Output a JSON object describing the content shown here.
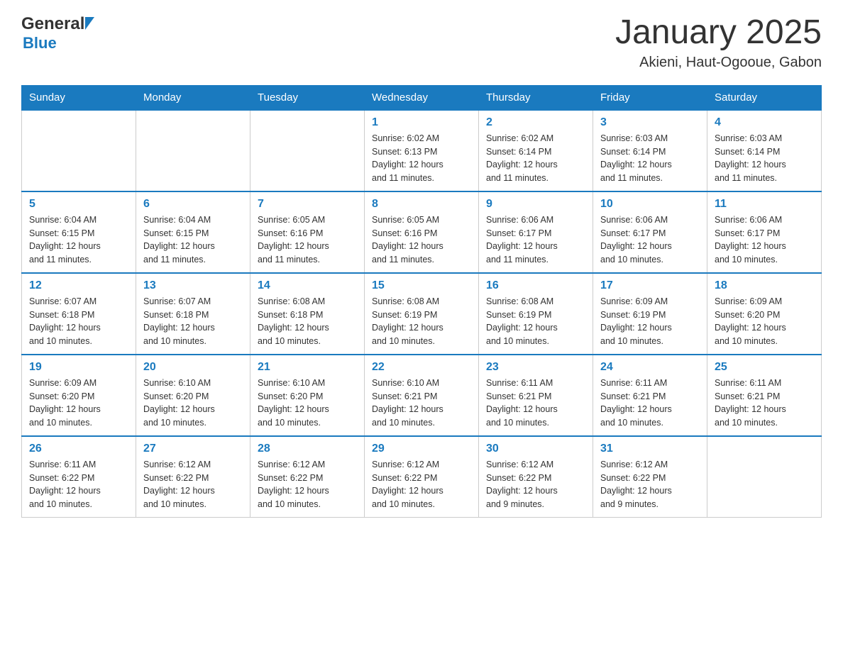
{
  "header": {
    "logo_general": "General",
    "logo_blue": "Blue",
    "title": "January 2025",
    "subtitle": "Akieni, Haut-Ogooue, Gabon"
  },
  "days_of_week": [
    "Sunday",
    "Monday",
    "Tuesday",
    "Wednesday",
    "Thursday",
    "Friday",
    "Saturday"
  ],
  "weeks": [
    [
      {
        "day": "",
        "info": ""
      },
      {
        "day": "",
        "info": ""
      },
      {
        "day": "",
        "info": ""
      },
      {
        "day": "1",
        "info": "Sunrise: 6:02 AM\nSunset: 6:13 PM\nDaylight: 12 hours\nand 11 minutes."
      },
      {
        "day": "2",
        "info": "Sunrise: 6:02 AM\nSunset: 6:14 PM\nDaylight: 12 hours\nand 11 minutes."
      },
      {
        "day": "3",
        "info": "Sunrise: 6:03 AM\nSunset: 6:14 PM\nDaylight: 12 hours\nand 11 minutes."
      },
      {
        "day": "4",
        "info": "Sunrise: 6:03 AM\nSunset: 6:14 PM\nDaylight: 12 hours\nand 11 minutes."
      }
    ],
    [
      {
        "day": "5",
        "info": "Sunrise: 6:04 AM\nSunset: 6:15 PM\nDaylight: 12 hours\nand 11 minutes."
      },
      {
        "day": "6",
        "info": "Sunrise: 6:04 AM\nSunset: 6:15 PM\nDaylight: 12 hours\nand 11 minutes."
      },
      {
        "day": "7",
        "info": "Sunrise: 6:05 AM\nSunset: 6:16 PM\nDaylight: 12 hours\nand 11 minutes."
      },
      {
        "day": "8",
        "info": "Sunrise: 6:05 AM\nSunset: 6:16 PM\nDaylight: 12 hours\nand 11 minutes."
      },
      {
        "day": "9",
        "info": "Sunrise: 6:06 AM\nSunset: 6:17 PM\nDaylight: 12 hours\nand 11 minutes."
      },
      {
        "day": "10",
        "info": "Sunrise: 6:06 AM\nSunset: 6:17 PM\nDaylight: 12 hours\nand 10 minutes."
      },
      {
        "day": "11",
        "info": "Sunrise: 6:06 AM\nSunset: 6:17 PM\nDaylight: 12 hours\nand 10 minutes."
      }
    ],
    [
      {
        "day": "12",
        "info": "Sunrise: 6:07 AM\nSunset: 6:18 PM\nDaylight: 12 hours\nand 10 minutes."
      },
      {
        "day": "13",
        "info": "Sunrise: 6:07 AM\nSunset: 6:18 PM\nDaylight: 12 hours\nand 10 minutes."
      },
      {
        "day": "14",
        "info": "Sunrise: 6:08 AM\nSunset: 6:18 PM\nDaylight: 12 hours\nand 10 minutes."
      },
      {
        "day": "15",
        "info": "Sunrise: 6:08 AM\nSunset: 6:19 PM\nDaylight: 12 hours\nand 10 minutes."
      },
      {
        "day": "16",
        "info": "Sunrise: 6:08 AM\nSunset: 6:19 PM\nDaylight: 12 hours\nand 10 minutes."
      },
      {
        "day": "17",
        "info": "Sunrise: 6:09 AM\nSunset: 6:19 PM\nDaylight: 12 hours\nand 10 minutes."
      },
      {
        "day": "18",
        "info": "Sunrise: 6:09 AM\nSunset: 6:20 PM\nDaylight: 12 hours\nand 10 minutes."
      }
    ],
    [
      {
        "day": "19",
        "info": "Sunrise: 6:09 AM\nSunset: 6:20 PM\nDaylight: 12 hours\nand 10 minutes."
      },
      {
        "day": "20",
        "info": "Sunrise: 6:10 AM\nSunset: 6:20 PM\nDaylight: 12 hours\nand 10 minutes."
      },
      {
        "day": "21",
        "info": "Sunrise: 6:10 AM\nSunset: 6:20 PM\nDaylight: 12 hours\nand 10 minutes."
      },
      {
        "day": "22",
        "info": "Sunrise: 6:10 AM\nSunset: 6:21 PM\nDaylight: 12 hours\nand 10 minutes."
      },
      {
        "day": "23",
        "info": "Sunrise: 6:11 AM\nSunset: 6:21 PM\nDaylight: 12 hours\nand 10 minutes."
      },
      {
        "day": "24",
        "info": "Sunrise: 6:11 AM\nSunset: 6:21 PM\nDaylight: 12 hours\nand 10 minutes."
      },
      {
        "day": "25",
        "info": "Sunrise: 6:11 AM\nSunset: 6:21 PM\nDaylight: 12 hours\nand 10 minutes."
      }
    ],
    [
      {
        "day": "26",
        "info": "Sunrise: 6:11 AM\nSunset: 6:22 PM\nDaylight: 12 hours\nand 10 minutes."
      },
      {
        "day": "27",
        "info": "Sunrise: 6:12 AM\nSunset: 6:22 PM\nDaylight: 12 hours\nand 10 minutes."
      },
      {
        "day": "28",
        "info": "Sunrise: 6:12 AM\nSunset: 6:22 PM\nDaylight: 12 hours\nand 10 minutes."
      },
      {
        "day": "29",
        "info": "Sunrise: 6:12 AM\nSunset: 6:22 PM\nDaylight: 12 hours\nand 10 minutes."
      },
      {
        "day": "30",
        "info": "Sunrise: 6:12 AM\nSunset: 6:22 PM\nDaylight: 12 hours\nand 9 minutes."
      },
      {
        "day": "31",
        "info": "Sunrise: 6:12 AM\nSunset: 6:22 PM\nDaylight: 12 hours\nand 9 minutes."
      },
      {
        "day": "",
        "info": ""
      }
    ]
  ]
}
